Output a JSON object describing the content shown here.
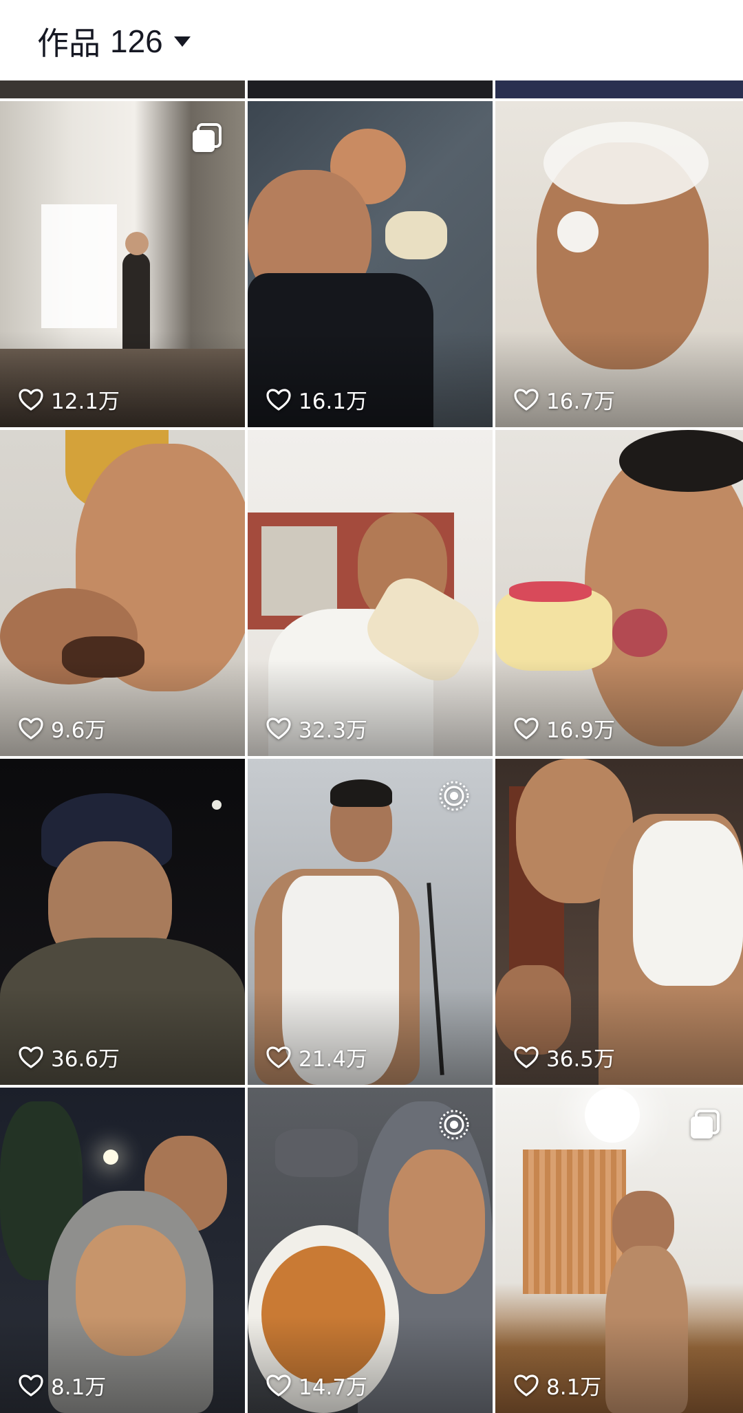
{
  "header": {
    "tab_label": "作品",
    "count": "126",
    "dropdown_icon": "caret-down-icon"
  },
  "colors": {
    "text_primary": "#161823",
    "overlay_text": "#ffffff",
    "background": "#ffffff"
  },
  "grid": {
    "columns": 3,
    "tiles": [
      {
        "likes": "12.1万",
        "badge": "multi-image-icon",
        "scene": "hallway room, person holding bags"
      },
      {
        "likes": "16.1万",
        "badge": "",
        "scene": "selfie with bowl of noodles and durian"
      },
      {
        "likes": "16.7万",
        "badge": "",
        "scene": "face covered in foam in shower"
      },
      {
        "likes": "9.6万",
        "badge": "",
        "scene": "close-up eating"
      },
      {
        "likes": "32.3万",
        "badge": "",
        "scene": "eating wrap in tank top"
      },
      {
        "likes": "16.9万",
        "badge": "",
        "scene": "eating cake close-up"
      },
      {
        "likes": "36.6万",
        "badge": "",
        "scene": "night outdoors in cap and jacket"
      },
      {
        "likes": "21.4万",
        "badge": "live-photo-icon",
        "scene": "standing in tank top"
      },
      {
        "likes": "36.5万",
        "badge": "",
        "scene": "thumbs up in tank top"
      },
      {
        "likes": "8.1万",
        "badge": "",
        "scene": "laughing in hood at night"
      },
      {
        "likes": "14.7万",
        "badge": "live-photo-icon",
        "scene": "hoodie with plate of noodles"
      },
      {
        "likes": "8.1万",
        "badge": "multi-image-icon",
        "scene": "room with wooden floor"
      }
    ]
  }
}
